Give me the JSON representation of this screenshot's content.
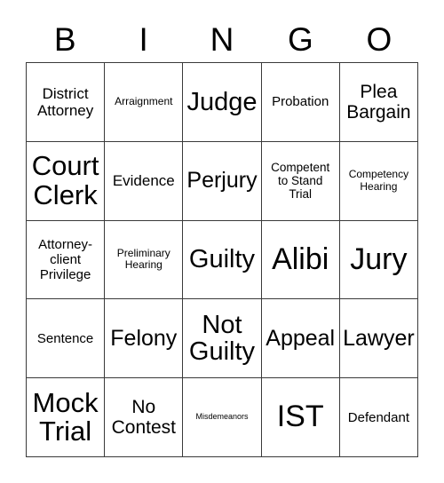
{
  "card": {
    "title": "BINGO",
    "header_letters": [
      "B",
      "I",
      "N",
      "G",
      "O"
    ],
    "columns": 5,
    "rows": 5,
    "border_color": "#3a3a3a",
    "cell_background": "#ffffff",
    "text_color": "#000000",
    "cells": [
      {
        "text": "District\nAttorney",
        "size": "fs-ml",
        "row": 1,
        "column": "B"
      },
      {
        "text": "Arraignment",
        "size": "fs-xs",
        "row": 1,
        "column": "I"
      },
      {
        "text": "Judge",
        "size": "fs-xxl",
        "row": 1,
        "column": "N"
      },
      {
        "text": "Probation",
        "size": "fs-m",
        "row": 1,
        "column": "G"
      },
      {
        "text": "Plea\nBargain",
        "size": "fs-l",
        "row": 1,
        "column": "O"
      },
      {
        "text": "Court\nClerk",
        "size": "fs-h1",
        "row": 2,
        "column": "B"
      },
      {
        "text": "Evidence",
        "size": "fs-ml",
        "row": 2,
        "column": "I"
      },
      {
        "text": "Perjury",
        "size": "fs-xl",
        "row": 2,
        "column": "N"
      },
      {
        "text": "Competent\nto Stand\nTrial",
        "size": "fs-s",
        "row": 2,
        "column": "G"
      },
      {
        "text": "Competency\nHearing",
        "size": "fs-xs",
        "row": 2,
        "column": "O"
      },
      {
        "text": "Attorney-\nclient\nPrivilege",
        "size": "fs-m",
        "row": 3,
        "column": "B"
      },
      {
        "text": "Preliminary\nHearing",
        "size": "fs-xs",
        "row": 3,
        "column": "I"
      },
      {
        "text": "Guilty",
        "size": "fs-xxl",
        "row": 3,
        "column": "N"
      },
      {
        "text": "Alibi",
        "size": "fs-h2",
        "row": 3,
        "column": "G"
      },
      {
        "text": "Jury",
        "size": "fs-h2",
        "row": 3,
        "column": "O"
      },
      {
        "text": "Sentence",
        "size": "fs-m",
        "row": 4,
        "column": "B"
      },
      {
        "text": "Felony",
        "size": "fs-xl",
        "row": 4,
        "column": "I"
      },
      {
        "text": "Not\nGuilty",
        "size": "fs-xxl",
        "row": 4,
        "column": "N"
      },
      {
        "text": "Appeal",
        "size": "fs-xl",
        "row": 4,
        "column": "G"
      },
      {
        "text": "Lawyer",
        "size": "fs-xl",
        "row": 4,
        "column": "O"
      },
      {
        "text": "Mock\nTrial",
        "size": "fs-h1",
        "row": 5,
        "column": "B"
      },
      {
        "text": "No\nContest",
        "size": "fs-l",
        "row": 5,
        "column": "I"
      },
      {
        "text": "Misdemeanors",
        "size": "fs-xxs",
        "row": 5,
        "column": "N"
      },
      {
        "text": "IST",
        "size": "fs-h2",
        "row": 5,
        "column": "G"
      },
      {
        "text": "Defendant",
        "size": "fs-m",
        "row": 5,
        "column": "O"
      }
    ]
  }
}
